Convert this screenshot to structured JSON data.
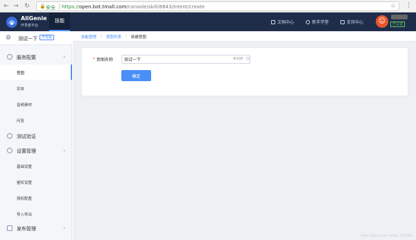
{
  "browser": {
    "secure_label": "安全",
    "url_scheme": "https://",
    "url_host": "open.bot.tmall.com",
    "url_path": "/console/skill/8843/intent/create"
  },
  "topnav": {
    "brand": "AliGenie",
    "brand_sub": "开发者平台",
    "active_tab": "技能",
    "links": [
      "文档中心",
      "新手学堂",
      "支持中心"
    ],
    "login_badge": "已认证"
  },
  "sidebar": {
    "project_name": "测试一下",
    "project_badge": "开发版",
    "sections": [
      {
        "label": "服务配置",
        "items": [
          "意图",
          "实体",
          "音频素材",
          "问答"
        ]
      },
      {
        "label": "测试验证"
      },
      {
        "label": "设置管理",
        "items": [
          "基础设置",
          "鉴权设置",
          "授权配置",
          "导入导出"
        ]
      },
      {
        "label": "发布管理"
      }
    ],
    "active_item": "意图"
  },
  "breadcrumb": [
    "技能管理",
    "意图列表",
    "新建意图"
  ],
  "form": {
    "intent_label": "意图名称",
    "intent_value": "测试一下",
    "counter": "4/100",
    "confirm_label": "确定"
  },
  "watermark": "https://blog.csdn.net/wz_375584"
}
